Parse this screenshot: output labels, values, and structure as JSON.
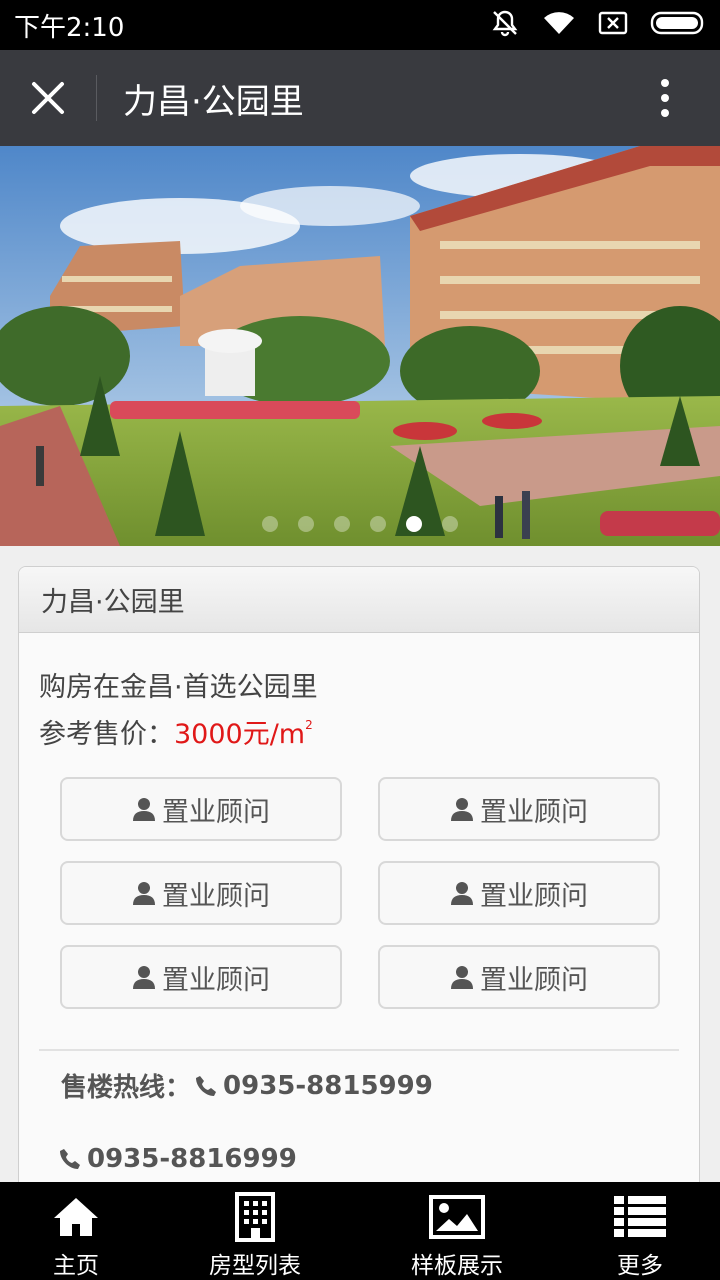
{
  "status_bar": {
    "time": "下午2:10"
  },
  "title_bar": {
    "title": "力昌·公园里"
  },
  "banner": {
    "slide_count": 6,
    "active_slide_index": 4
  },
  "card": {
    "header": "力昌·公园里",
    "slogan": "购房在金昌·首选公园里",
    "price_label": "参考售价：",
    "price_value": "3000元/m",
    "price_unit_sup": "2",
    "adviser_buttons": [
      "置业顾问",
      "置业顾问",
      "置业顾问",
      "置业顾问",
      "置业顾问",
      "置业顾问"
    ],
    "hotline_label": "售楼热线：",
    "hotline_1": "0935-8815999",
    "hotline_2": "0935-8816999"
  },
  "tab_bar": {
    "tabs": [
      {
        "label": "主页",
        "icon": "home-icon"
      },
      {
        "label": "房型列表",
        "icon": "building-icon"
      },
      {
        "label": "样板展示",
        "icon": "picture-icon"
      },
      {
        "label": "更多",
        "icon": "list-icon"
      }
    ]
  },
  "colors": {
    "title_bar": "#393a3f",
    "price": "#e01818",
    "tab_bar": "#000000"
  }
}
